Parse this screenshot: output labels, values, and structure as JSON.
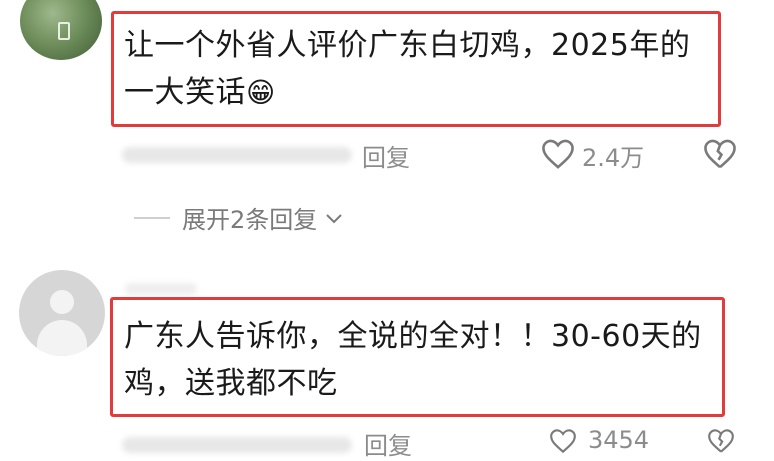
{
  "comment1": {
    "text_line1": "让一个外省人评价广东白切鸡，2025年的",
    "text_line2": "一大笑话",
    "emoji": "😁",
    "reply_label": "回复",
    "like_count": "2.4万"
  },
  "expand_replies": {
    "label": "展开2条回复"
  },
  "comment2": {
    "text_line1": "广东人告诉你，全说的全对！！30-60天的",
    "text_line2": "鸡，送我都不吃",
    "reply_label": "回复",
    "like_count": "3454"
  },
  "colors": {
    "highlight_box": "#e23b3b",
    "meta_text": "#8c8c8c"
  }
}
